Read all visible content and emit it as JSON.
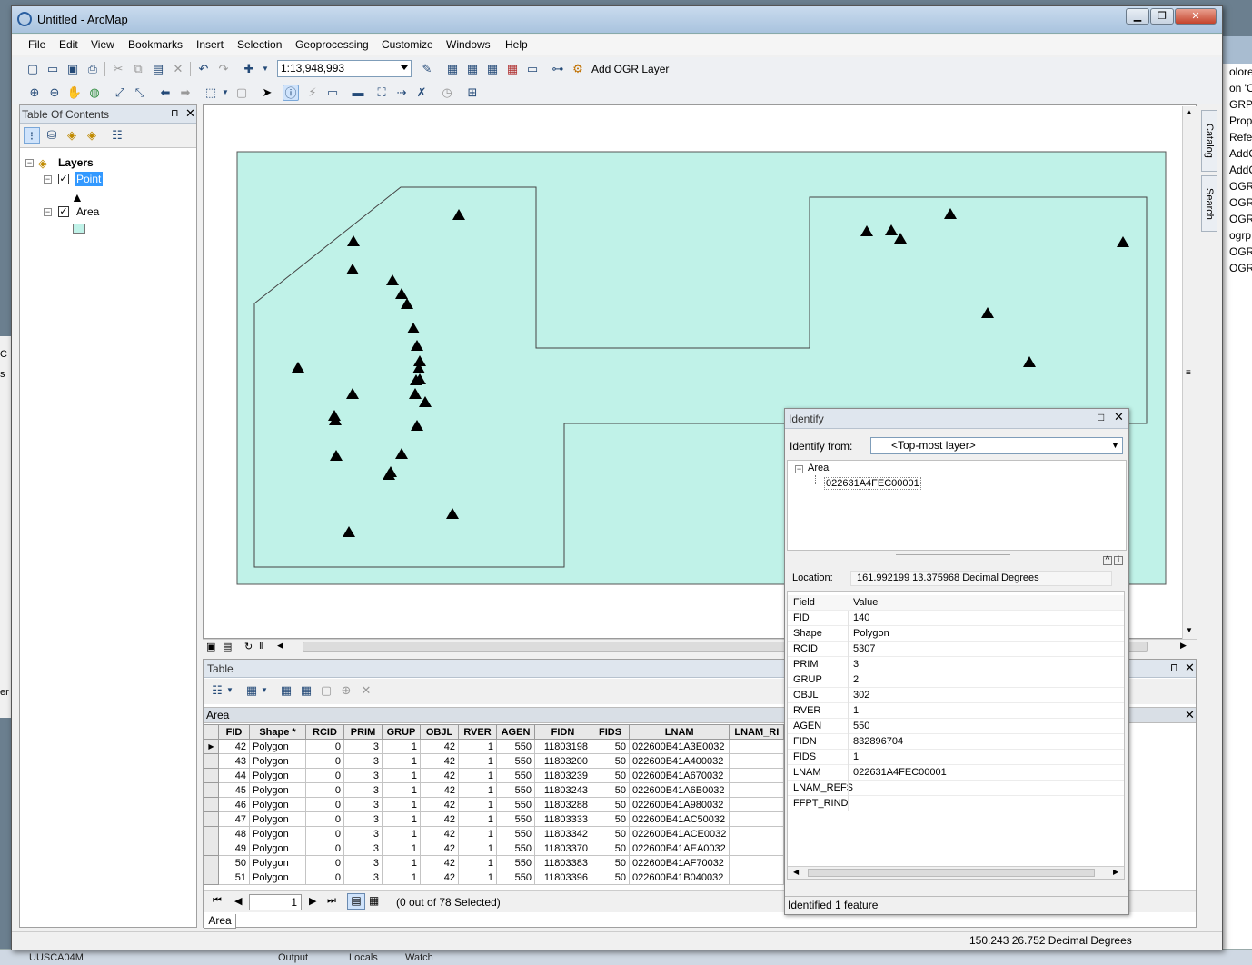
{
  "window": {
    "title": "Untitled - ArcMap"
  },
  "menu": [
    "File",
    "Edit",
    "View",
    "Bookmarks",
    "Insert",
    "Selection",
    "Geoprocessing",
    "Customize",
    "Windows",
    "Help"
  ],
  "toolbar": {
    "scale": "1:13,948,993",
    "add_ogr_label": "Add OGR Layer"
  },
  "toc": {
    "title": "Table Of Contents",
    "root": "Layers",
    "layers": [
      {
        "name": "Point"
      },
      {
        "name": "Area"
      }
    ]
  },
  "dock": {
    "catalog": "Catalog",
    "search": "Search"
  },
  "background": {
    "right_items": [
      "olorer",
      "on 'OG",
      "GRPlu",
      "Prop",
      "Refer",
      "AddO",
      "AddO",
      "OGR",
      "OGR",
      "OGR",
      "ogrp",
      "OGR",
      "OGR"
    ],
    "left_items": [
      "C",
      "s",
      "er"
    ],
    "bottom_items": [
      "Output",
      "Locals",
      "Watch"
    ],
    "bottom_left": "UUSCA04M"
  },
  "table": {
    "title": "Table",
    "tab": "Area",
    "columns": [
      "FID",
      "Shape *",
      "RCID",
      "PRIM",
      "GRUP",
      "OBJL",
      "RVER",
      "AGEN",
      "FIDN",
      "FIDS",
      "LNAM",
      "LNAM_RI"
    ],
    "rows": [
      [
        "42",
        "Polygon",
        "0",
        "3",
        "1",
        "42",
        "1",
        "550",
        "11803198",
        "50",
        "022600B41A3E0032",
        ""
      ],
      [
        "43",
        "Polygon",
        "0",
        "3",
        "1",
        "42",
        "1",
        "550",
        "11803200",
        "50",
        "022600B41A400032",
        ""
      ],
      [
        "44",
        "Polygon",
        "0",
        "3",
        "1",
        "42",
        "1",
        "550",
        "11803239",
        "50",
        "022600B41A670032",
        ""
      ],
      [
        "45",
        "Polygon",
        "0",
        "3",
        "1",
        "42",
        "1",
        "550",
        "11803243",
        "50",
        "022600B41A6B0032",
        ""
      ],
      [
        "46",
        "Polygon",
        "0",
        "3",
        "1",
        "42",
        "1",
        "550",
        "11803288",
        "50",
        "022600B41A980032",
        ""
      ],
      [
        "47",
        "Polygon",
        "0",
        "3",
        "1",
        "42",
        "1",
        "550",
        "11803333",
        "50",
        "022600B41AC50032",
        ""
      ],
      [
        "48",
        "Polygon",
        "0",
        "3",
        "1",
        "42",
        "1",
        "550",
        "11803342",
        "50",
        "022600B41ACE0032",
        ""
      ],
      [
        "49",
        "Polygon",
        "0",
        "3",
        "1",
        "42",
        "1",
        "550",
        "11803370",
        "50",
        "022600B41AEA0032",
        ""
      ],
      [
        "50",
        "Polygon",
        "0",
        "3",
        "1",
        "42",
        "1",
        "550",
        "11803383",
        "50",
        "022600B41AF70032",
        ""
      ],
      [
        "51",
        "Polygon",
        "0",
        "3",
        "1",
        "42",
        "1",
        "550",
        "11803396",
        "50",
        "022600B41B040032",
        ""
      ]
    ],
    "record": "1",
    "selection": "(0 out of 78 Selected)",
    "bottom_tab": "Area"
  },
  "identify": {
    "title": "Identify",
    "from_label": "Identify from:",
    "from_value": "<Top-most layer>",
    "tree_layer": "Area",
    "tree_feature": "022631A4FEC00001",
    "location_label": "Location:",
    "location_value": "161.992199  13.375968 Decimal Degrees",
    "field_header": "Field",
    "value_header": "Value",
    "fields": [
      {
        "f": "FID",
        "v": "140"
      },
      {
        "f": "Shape",
        "v": "Polygon"
      },
      {
        "f": "RCID",
        "v": "5307"
      },
      {
        "f": "PRIM",
        "v": "3"
      },
      {
        "f": "GRUP",
        "v": "2"
      },
      {
        "f": "OBJL",
        "v": "302"
      },
      {
        "f": "RVER",
        "v": "1"
      },
      {
        "f": "AGEN",
        "v": "550"
      },
      {
        "f": "FIDN",
        "v": "832896704"
      },
      {
        "f": "FIDS",
        "v": "1"
      },
      {
        "f": "LNAM",
        "v": "022631A4FEC00001"
      },
      {
        "f": "LNAM_REFS",
        "v": ""
      },
      {
        "f": "FFPT_RIND",
        "v": ""
      }
    ],
    "status": "Identified 1 feature"
  },
  "status": {
    "coords": "150.243  26.752 Decimal Degrees"
  },
  "colors": {
    "area_fill": "#c0f2e8",
    "point": "#000000",
    "selection": "#3399ff"
  }
}
